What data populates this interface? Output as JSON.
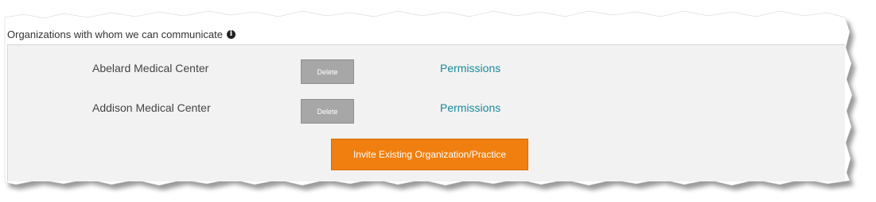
{
  "section": {
    "title": "Organizations with whom we can communicate",
    "info_icon": "info-circle-icon"
  },
  "organizations": [
    {
      "name": "Abelard Medical Center",
      "delete_label": "Delete",
      "permissions_label": "Permissions"
    },
    {
      "name": "Addison Medical Center",
      "delete_label": "Delete",
      "permissions_label": "Permissions"
    }
  ],
  "actions": {
    "invite_label": "Invite Existing Organization/Practice"
  },
  "colors": {
    "panel_bg": "#f2f2f2",
    "delete_bg": "#a7a7a7",
    "link": "#1a8a9a",
    "accent": "#f07f0f"
  }
}
